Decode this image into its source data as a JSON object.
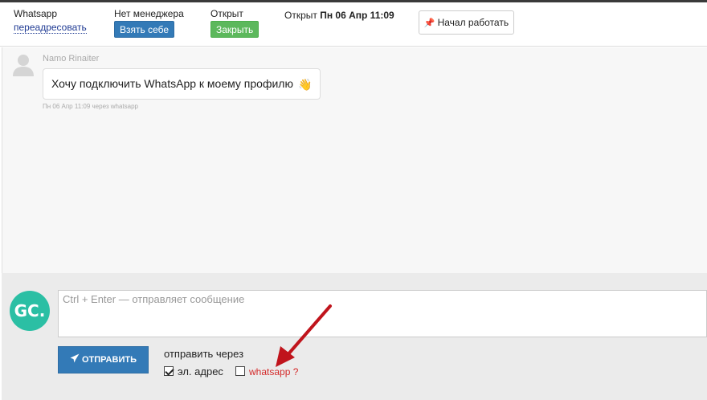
{
  "header": {
    "channel": {
      "label": "Whatsapp",
      "redirect_link": "переадресовать"
    },
    "manager": {
      "label": "Нет менеджера",
      "take_button": "Взять себе"
    },
    "status": {
      "label": "Открыт",
      "close_button": "Закрыть"
    },
    "opened": {
      "prefix": "Открыт",
      "datetime": "Пн 06 Апр 11:09"
    },
    "start_button": "Начал работать"
  },
  "chat": {
    "messages": [
      {
        "sender": "Namo Rinaiter",
        "text": "Хочу подключить WhatsApp к моему профилю",
        "emoji": "👋",
        "meta": "Пн 06 Апр 11:09 через whatsapp"
      }
    ]
  },
  "compose": {
    "avatar_initials": "GC.",
    "placeholder": "Ctrl + Enter — отправляет сообщение",
    "send_button": "ОТПРАВИТЬ",
    "send_via_label": "отправить через",
    "options": [
      {
        "label": "эл. адрес",
        "checked": true
      },
      {
        "label": "whatsapp ?",
        "checked": false
      }
    ]
  },
  "colors": {
    "primary": "#337ab7",
    "success": "#5cb85c",
    "avatar": "#2bbfa4",
    "annotation_arrow": "#c0141c",
    "whatsapp_label": "#d42a2a"
  }
}
